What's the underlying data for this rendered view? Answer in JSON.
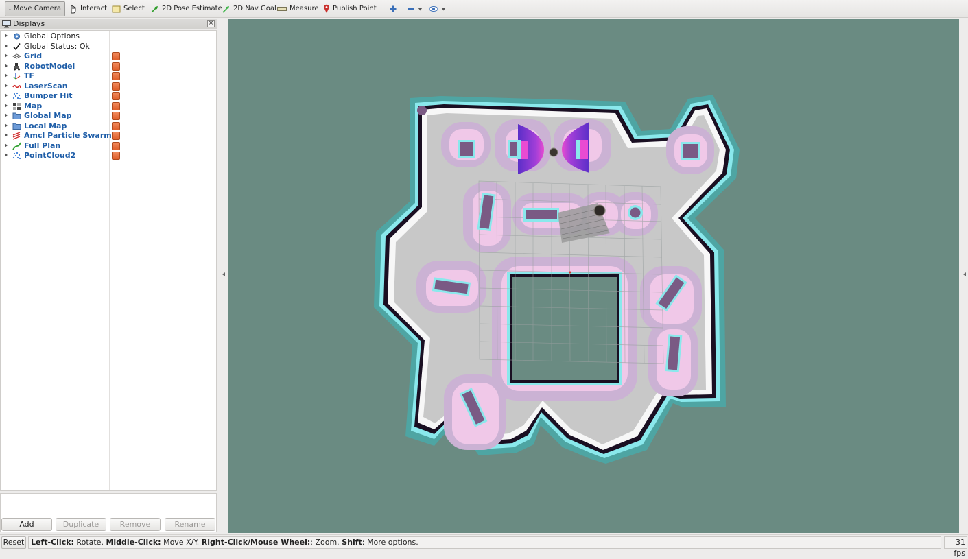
{
  "toolbar": {
    "move_camera": "Move Camera",
    "interact": "Interact",
    "select": "Select",
    "pose_estimate": "2D Pose Estimate",
    "nav_goal": "2D Nav Goal",
    "measure": "Measure",
    "publish_point": "Publish Point"
  },
  "displays": {
    "title": "Displays",
    "items": [
      {
        "label": "Global Options",
        "icon": "gear-icon",
        "checked": null
      },
      {
        "label": "Global Status: Ok",
        "icon": "checkmark-icon",
        "checked": null
      },
      {
        "label": "Grid",
        "icon": "grid-icon",
        "checked": true
      },
      {
        "label": "RobotModel",
        "icon": "robot-icon",
        "checked": true
      },
      {
        "label": "TF",
        "icon": "axes-icon",
        "checked": true
      },
      {
        "label": "LaserScan",
        "icon": "laser-icon",
        "checked": true
      },
      {
        "label": "Bumper Hit",
        "icon": "pointcloud-icon",
        "checked": true
      },
      {
        "label": "Map",
        "icon": "map-icon",
        "checked": true
      },
      {
        "label": "Global Map",
        "icon": "folder-icon",
        "checked": true
      },
      {
        "label": "Local Map",
        "icon": "folder-icon",
        "checked": true
      },
      {
        "label": "Amcl Particle Swarm",
        "icon": "pose-array-icon",
        "checked": true
      },
      {
        "label": "Full Plan",
        "icon": "path-icon",
        "checked": true
      },
      {
        "label": "PointCloud2",
        "icon": "pointcloud-icon",
        "checked": true
      }
    ],
    "buttons": {
      "add": "Add",
      "duplicate": "Duplicate",
      "remove": "Remove",
      "rename": "Rename"
    }
  },
  "status": {
    "reset": "Reset",
    "hint_left_click": "Left-Click:",
    "hint_rotate": " Rotate. ",
    "hint_middle_click": "Middle-Click:",
    "hint_move": " Move X/Y. ",
    "hint_right_click": "Right-Click/Mouse Wheel:",
    "hint_zoom": ": Zoom. ",
    "hint_shift": "Shift",
    "hint_more": ": More options.",
    "fps": "31 fps"
  },
  "colors": {
    "viewport_bg": "#6a8b82",
    "map_free": "#c8c8c8",
    "inflation_outer": "#cbb2d4",
    "inflation_inner": "#f0c8e8",
    "inscribed": "#8ae8ec",
    "lethal": "#7a5a84",
    "costmap_outer_ring": "#4ea5a3",
    "high_cost": "#6b2bb5",
    "checkbox": "#e8743f",
    "label_blue": "#1f5ea8"
  }
}
